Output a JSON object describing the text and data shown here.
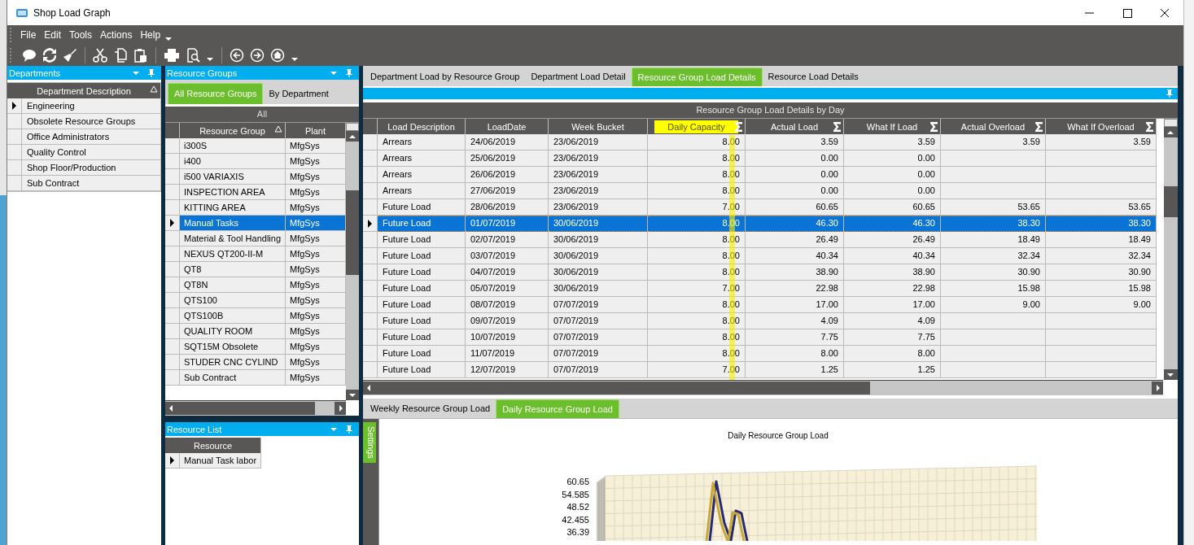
{
  "window": {
    "title": "Shop Load Graph"
  },
  "menu": [
    {
      "label": "File"
    },
    {
      "label": "Edit"
    },
    {
      "label": "Tools"
    },
    {
      "label": "Actions"
    },
    {
      "label": "Help"
    }
  ],
  "departments": {
    "title": "Departments",
    "column": "Department Description",
    "rows": [
      {
        "text": "Engineering",
        "selected": true
      },
      {
        "text": "Obsolete Resource Groups",
        "selected": false
      },
      {
        "text": "Office Administrators",
        "selected": false
      },
      {
        "text": "Quality Control",
        "selected": false
      },
      {
        "text": "Shop Floor/Production",
        "selected": false
      },
      {
        "text": "Sub Contract",
        "selected": false
      }
    ]
  },
  "resource_groups": {
    "title": "Resource Groups",
    "tabs": [
      {
        "label": "All Resource Groups",
        "selected": true
      },
      {
        "label": "By Department",
        "selected": false
      }
    ],
    "group_label": "All",
    "columns": [
      "Resource Group",
      "Plant"
    ],
    "rows": [
      {
        "name": "i300S",
        "plant": "MfgSys",
        "selected": false
      },
      {
        "name": "i400",
        "plant": "MfgSys",
        "selected": false
      },
      {
        "name": "i500 VARIAXIS",
        "plant": "MfgSys",
        "selected": false
      },
      {
        "name": "INSPECTION AREA",
        "plant": "MfgSys",
        "selected": false
      },
      {
        "name": "KITTING AREA",
        "plant": "MfgSys",
        "selected": false
      },
      {
        "name": "Manual Tasks",
        "plant": "MfgSys",
        "selected": true
      },
      {
        "name": "Material & Tool Handling",
        "plant": "MfgSys",
        "selected": false
      },
      {
        "name": "NEXUS QT200-II-M",
        "plant": "MfgSys",
        "selected": false
      },
      {
        "name": "QT8",
        "plant": "MfgSys",
        "selected": false
      },
      {
        "name": "QT8N",
        "plant": "MfgSys",
        "selected": false
      },
      {
        "name": "QTS100",
        "plant": "MfgSys",
        "selected": false
      },
      {
        "name": "QTS100B",
        "plant": "MfgSys",
        "selected": false
      },
      {
        "name": "QUALITY ROOM",
        "plant": "MfgSys",
        "selected": false
      },
      {
        "name": "SQT15M Obsolete",
        "plant": "MfgSys",
        "selected": false
      },
      {
        "name": "STUDER CNC CYLIND",
        "plant": "MfgSys",
        "selected": false
      },
      {
        "name": "Sub Contract",
        "plant": "MfgSys",
        "selected": false
      }
    ]
  },
  "resource_list": {
    "title": "Resource List",
    "column": "Resource",
    "rows": [
      {
        "text": "Manual Task labor",
        "selected": true
      }
    ]
  },
  "main_tabs": [
    {
      "label": "Department Load by Resource Group",
      "selected": false
    },
    {
      "label": "Department Load Detail",
      "selected": false
    },
    {
      "label": "Resource Group Load Details",
      "selected": true
    },
    {
      "label": "Resource Load Details",
      "selected": false
    }
  ],
  "grid": {
    "title": "Resource Group Load Details by Day",
    "columns": [
      {
        "label": "Load Description",
        "sum": false,
        "highlighted": false
      },
      {
        "label": "LoadDate",
        "sum": false,
        "highlighted": false
      },
      {
        "label": "Week Bucket",
        "sum": false,
        "highlighted": false
      },
      {
        "label": "Daily Capacity",
        "sum": true,
        "highlighted": true
      },
      {
        "label": "Actual Load",
        "sum": true,
        "highlighted": false
      },
      {
        "label": "What If Load",
        "sum": true,
        "highlighted": false
      },
      {
        "label": "Actual Overload",
        "sum": true,
        "highlighted": false
      },
      {
        "label": "What If Overload",
        "sum": true,
        "highlighted": false
      }
    ],
    "rows": [
      {
        "cells": [
          "Arrears",
          "24/06/2019",
          "23/06/2019",
          "8.00",
          "3.59",
          "3.59",
          "3.59",
          "3.59"
        ],
        "selected": false
      },
      {
        "cells": [
          "Arrears",
          "25/06/2019",
          "23/06/2019",
          "8.00",
          "0.00",
          "0.00",
          null,
          null
        ],
        "selected": false
      },
      {
        "cells": [
          "Arrears",
          "26/06/2019",
          "23/06/2019",
          "8.00",
          "0.00",
          "0.00",
          null,
          null
        ],
        "selected": false
      },
      {
        "cells": [
          "Arrears",
          "27/06/2019",
          "23/06/2019",
          "8.00",
          "0.00",
          "0.00",
          null,
          null
        ],
        "selected": false
      },
      {
        "cells": [
          "Future Load",
          "28/06/2019",
          "23/06/2019",
          "7.00",
          "60.65",
          "60.65",
          "53.65",
          "53.65"
        ],
        "selected": false
      },
      {
        "cells": [
          "Future Load",
          "01/07/2019",
          "30/06/2019",
          "8.00",
          "46.30",
          "46.30",
          "38.30",
          "38.30"
        ],
        "selected": true
      },
      {
        "cells": [
          "Future Load",
          "02/07/2019",
          "30/06/2019",
          "8.00",
          "26.49",
          "26.49",
          "18.49",
          "18.49"
        ],
        "selected": false
      },
      {
        "cells": [
          "Future Load",
          "03/07/2019",
          "30/06/2019",
          "8.00",
          "40.34",
          "40.34",
          "32.34",
          "32.34"
        ],
        "selected": false
      },
      {
        "cells": [
          "Future Load",
          "04/07/2019",
          "30/06/2019",
          "8.00",
          "38.90",
          "38.90",
          "30.90",
          "30.90"
        ],
        "selected": false
      },
      {
        "cells": [
          "Future Load",
          "05/07/2019",
          "30/06/2019",
          "7.00",
          "22.98",
          "22.98",
          "15.98",
          "15.98"
        ],
        "selected": false
      },
      {
        "cells": [
          "Future Load",
          "08/07/2019",
          "07/07/2019",
          "8.00",
          "17.00",
          "17.00",
          "9.00",
          "9.00"
        ],
        "selected": false
      },
      {
        "cells": [
          "Future Load",
          "09/07/2019",
          "07/07/2019",
          "8.00",
          "4.09",
          "4.09",
          null,
          null
        ],
        "selected": false
      },
      {
        "cells": [
          "Future Load",
          "10/07/2019",
          "07/07/2019",
          "8.00",
          "7.75",
          "7.75",
          null,
          null
        ],
        "selected": false
      },
      {
        "cells": [
          "Future Load",
          "11/07/2019",
          "07/07/2019",
          "8.00",
          "8.00",
          "8.00",
          null,
          null
        ],
        "selected": false
      },
      {
        "cells": [
          "Future Load",
          "12/07/2019",
          "07/07/2019",
          "7.00",
          "1.25",
          "1.25",
          null,
          null
        ],
        "selected": false
      }
    ]
  },
  "bottom_tabs": [
    {
      "label": "Weekly Resource Group Load",
      "selected": false
    },
    {
      "label": "Daily Resource Group Load",
      "selected": true
    }
  ],
  "settings_tab": "Settings",
  "chart": {
    "title": "Daily Resource Group Load",
    "axis_labels": [
      "60.65",
      "54.585",
      "48.52",
      "42.455",
      "36.39"
    ]
  }
}
